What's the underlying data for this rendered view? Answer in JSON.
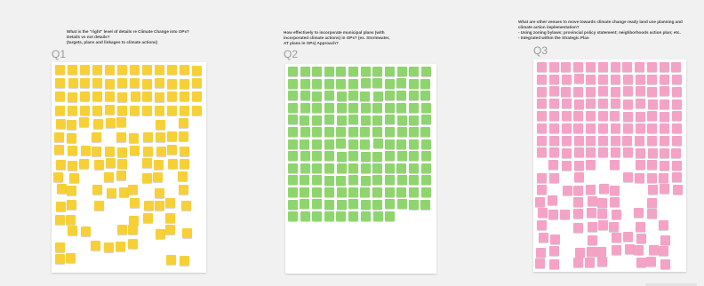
{
  "colors": {
    "background": "#f1f1f1",
    "board": "#ffffff",
    "yellow_note": "#f7d038",
    "green_note": "#8fd56e",
    "pink_note": "#f4a3c7"
  },
  "sections": [
    {
      "label": "Q1",
      "prompt": "What is the \"right\" level of details re Climate Change into OPs?\nDetails vs not details?\n(targets, plans and linkages to climate actions)",
      "note_color": "yellow",
      "note_icon": "sticky-note-icon"
    },
    {
      "label": "Q2",
      "prompt": "How effectively to incorporate municipal plans (with\nincorporated climate actions) in OPs? (ex. Stormwater,\nAT plans in OPs) Approach?",
      "note_color": "green",
      "note_icon": "sticky-note-icon"
    },
    {
      "label": "Q3",
      "prompt": "What are other venues to move towards climate change ready land use planning and\nclimate action implementation?\n- Using zoning bylaws; provincial policy statement; neighborhoods action plan; etc.\n- Integrated within the Strategic Plan",
      "note_color": "pink",
      "note_icon": "sticky-note-icon"
    }
  ]
}
